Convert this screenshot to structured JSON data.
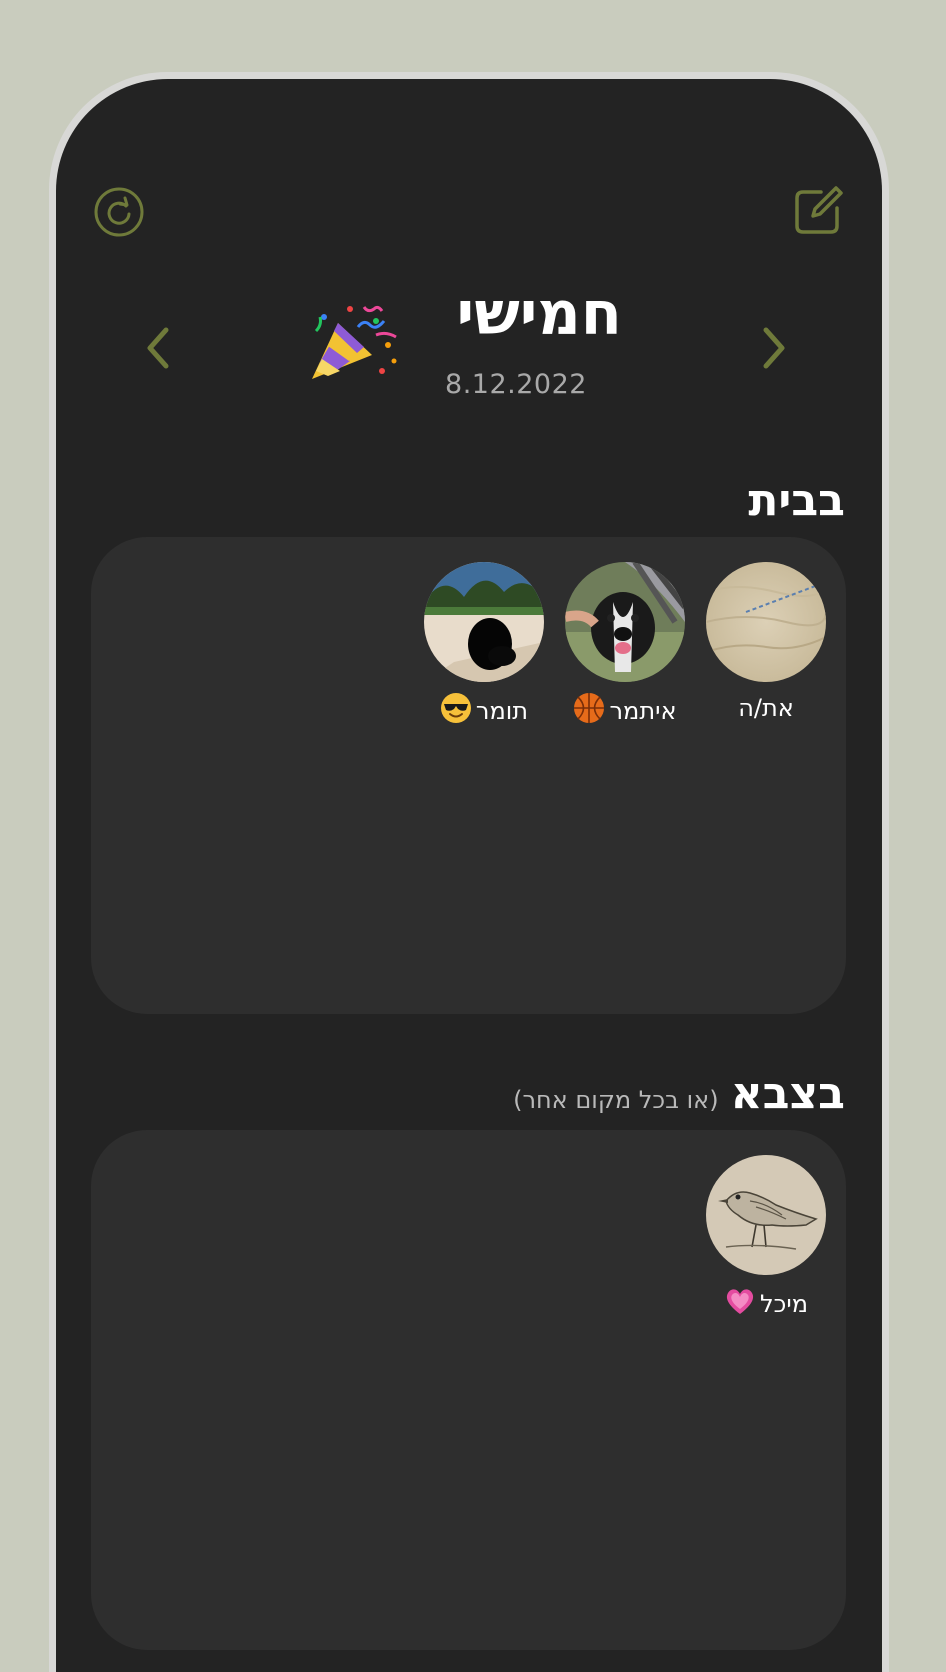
{
  "header": {
    "day_name": "חמישי",
    "date": "8.12.2022"
  },
  "icons": {
    "refresh": "refresh-circle-icon",
    "edit": "compose-edit-icon",
    "prev": "chevron-left-icon",
    "next": "chevron-right-icon",
    "party": "party-popper-icon"
  },
  "colors": {
    "accent": "#6f7a3a",
    "background": "#232323",
    "card": "#2e2e2e",
    "page": "#c9ccbe"
  },
  "sections": {
    "home": {
      "title": "בבית",
      "people": [
        {
          "name": "את/ה",
          "status_emoji": ""
        },
        {
          "name": "איתמר",
          "status_emoji": "basketball"
        },
        {
          "name": "תומר",
          "status_emoji": "sunglasses-face"
        }
      ]
    },
    "army": {
      "title": "בצבא",
      "subtitle": "(או בכל מקום אחר)",
      "people": [
        {
          "name": "מיכל",
          "status_emoji": "pink-heart"
        }
      ]
    }
  }
}
